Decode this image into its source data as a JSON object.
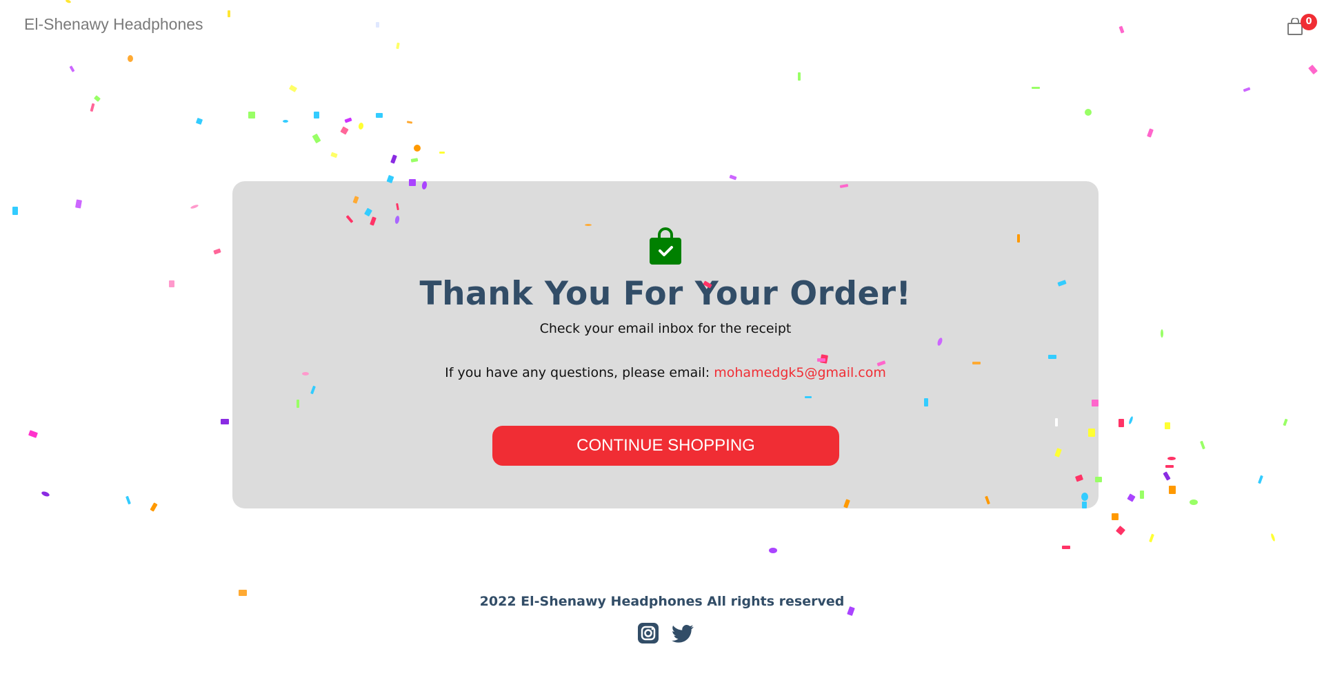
{
  "header": {
    "logo_text": "El-Shenawy Headphones",
    "cart_count": "0"
  },
  "success": {
    "title": "Thank You For Your Order!",
    "receipt_text": "Check your email inbox for the receipt",
    "questions_text": "If you have any questions, please email:",
    "email": "mohamedgk5@gmail.com",
    "button_label": "CONTINUE SHOPPING"
  },
  "footer": {
    "copyright": "2022 El-Shenawy Headphones All rights reserved",
    "social_icons": [
      "instagram-icon",
      "twitter-icon"
    ]
  },
  "colors": {
    "accent": "#f02d34",
    "text_dark": "#324d67",
    "card_bg": "#dcdcdc",
    "bag_green": "#008000"
  }
}
